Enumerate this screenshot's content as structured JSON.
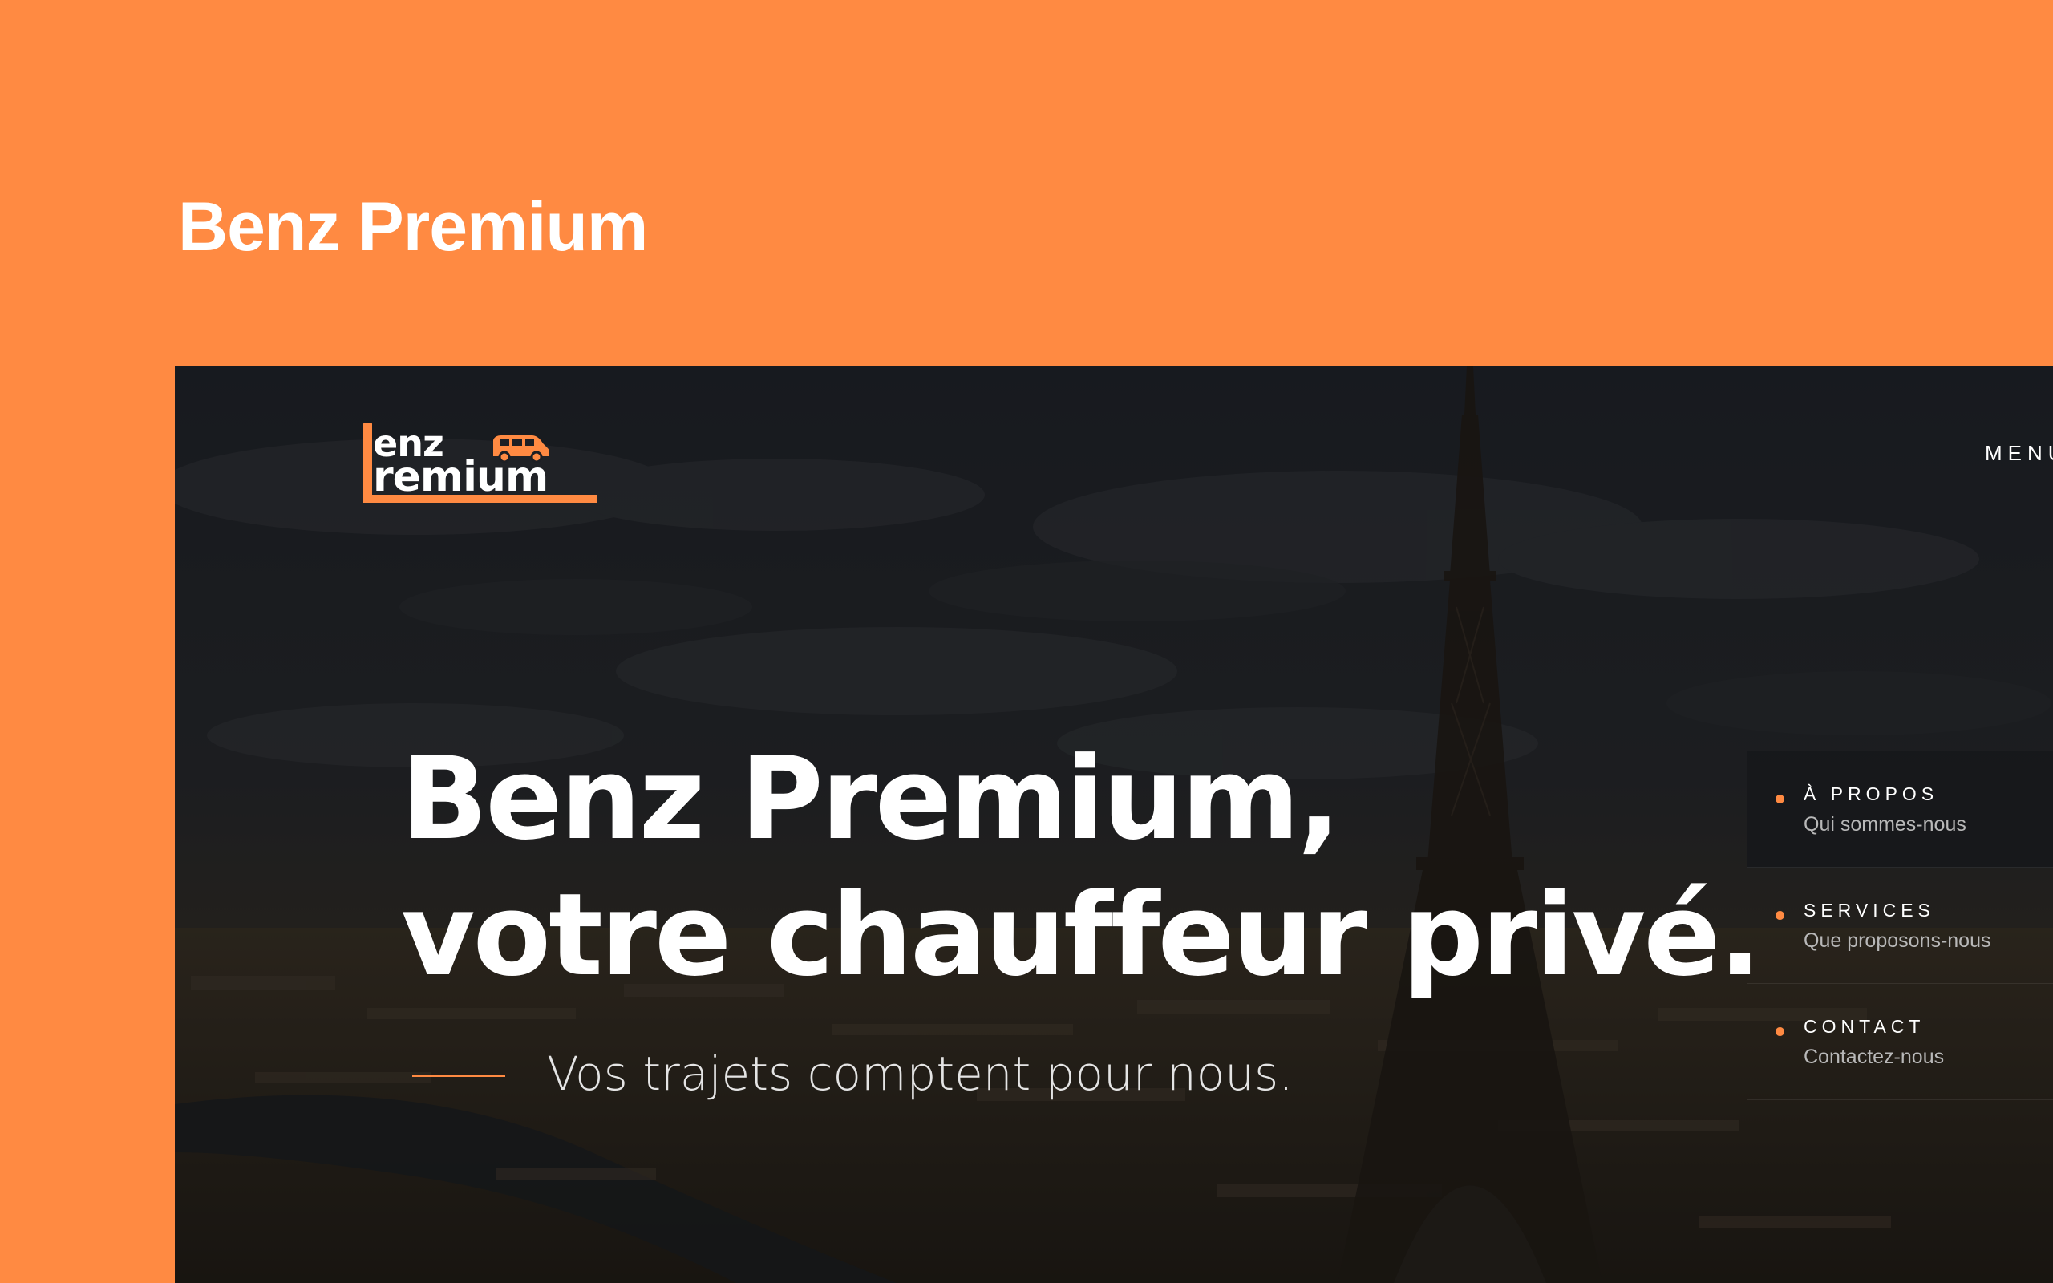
{
  "page": {
    "title": "Benz Premium",
    "background_color": "#FF8A42"
  },
  "site": {
    "logo": {
      "line1": "enz",
      "line2": "remium",
      "icon": "van-icon",
      "accent_color": "#FF8A42"
    },
    "menu_label": "MENU",
    "hero": {
      "headline_line1": "Benz Premium,",
      "headline_line2": "votre chauffeur privé.",
      "tagline": "Vos trajets comptent pour nous."
    },
    "side_nav": [
      {
        "title": "À PROPOS",
        "subtitle": "Qui sommes-nous"
      },
      {
        "title": "SERVICES",
        "subtitle": "Que proposons-nous"
      },
      {
        "title": "CONTACT",
        "subtitle": "Contactez-nous"
      }
    ]
  }
}
